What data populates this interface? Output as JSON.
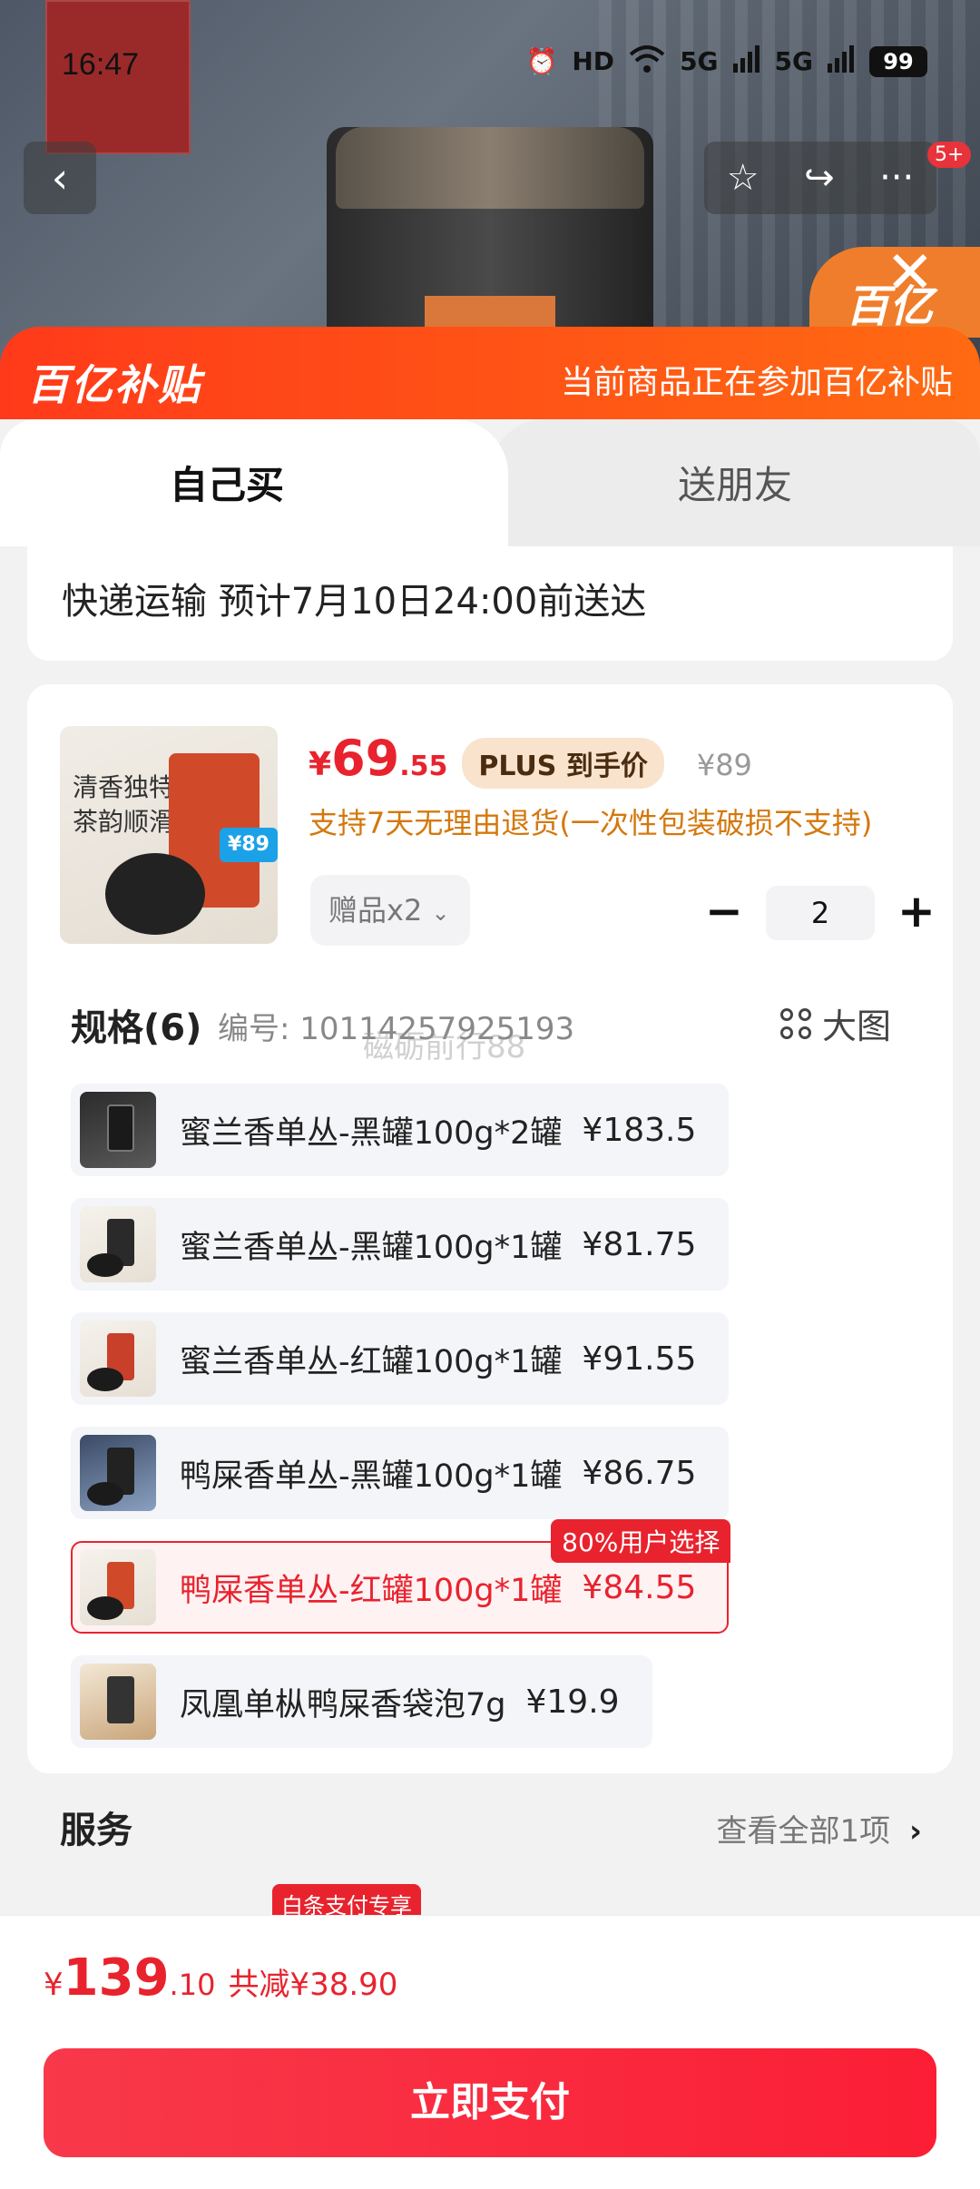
{
  "status": {
    "time": "16:47",
    "battery": "99",
    "hd": "HD",
    "net": "5G"
  },
  "nav": {
    "cart_badge": "5+"
  },
  "banner": {
    "logo": "百亿补贴",
    "text": "当前商品正在参加百亿补贴"
  },
  "tabs": {
    "self": "自己买",
    "friend": "送朋友"
  },
  "delivery": {
    "text": "快递运输 预计7月10日24:00前送达"
  },
  "product": {
    "thumb_text_1": "清香独特",
    "thumb_text_2": "茶韵顺滑",
    "thumb_badge": "¥89",
    "price_currency": "¥",
    "price_int": "69",
    "price_dec": ".55",
    "plus_tag": "PLUS 到手价",
    "original_price": "¥89",
    "return_policy": "支持7天无理由退货(一次性包装破损不支持)",
    "gift_label": "赠品x2",
    "quantity": "2"
  },
  "spec": {
    "title": "规格(6)",
    "code": "编号: 10114257925193",
    "watermark": "磁砺前行88",
    "big_image": "大图",
    "items": [
      {
        "label": "蜜兰香单丛-黑罐100g*2罐",
        "price": "¥183.5",
        "selected": false
      },
      {
        "label": "蜜兰香单丛-黑罐100g*1罐",
        "price": "¥81.75",
        "selected": false
      },
      {
        "label": "蜜兰香单丛-红罐100g*1罐",
        "price": "¥91.55",
        "selected": false
      },
      {
        "label": "鸭屎香单丛-黑罐100g*1罐",
        "price": "¥86.75",
        "selected": false
      },
      {
        "label": "鸭屎香单丛-红罐100g*1罐",
        "price": "¥84.55",
        "selected": true,
        "flag": "80%用户选择"
      },
      {
        "label": "凤凰单枞鸭屎香袋泡7g",
        "price": "¥19.9",
        "selected": false
      }
    ]
  },
  "service": {
    "title": "服务",
    "more": "查看全部1项",
    "baitiao_tag": "白条支付专享"
  },
  "footer": {
    "currency": "¥",
    "total_int": "139",
    "total_dec": ".10",
    "saved": "共减¥38.90",
    "pay_button": "立即支付"
  }
}
